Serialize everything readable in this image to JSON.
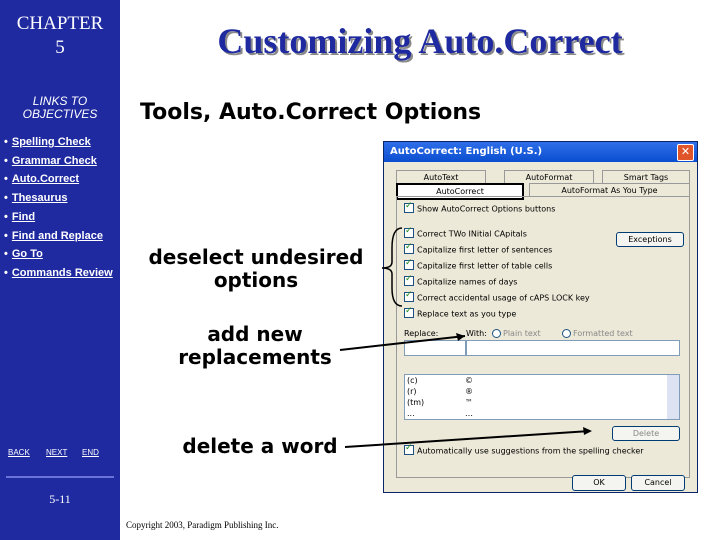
{
  "sidebar": {
    "chapter": "CHAPTER",
    "chapter_num": "5",
    "links_title_1": "LINKS TO",
    "links_title_2": "OBJECTIVES",
    "links": [
      "Spelling Check",
      "Grammar Check",
      "Auto.Correct",
      "Thesaurus",
      "Find",
      "Find and Replace",
      "Go To",
      "Commands Review"
    ],
    "nav": {
      "back": "BACK",
      "next": "NEXT",
      "end": "END"
    },
    "page_number": "5-11"
  },
  "slide": {
    "title": "Customizing Auto.Correct",
    "subtitle": "Tools, Auto.Correct Options",
    "callout_deselect": [
      "deselect undesired",
      "options"
    ],
    "callout_add": [
      "add new",
      "replacements"
    ],
    "callout_delete": "delete a word",
    "copyright": "Copyright 2003, Paradigm Publishing Inc."
  },
  "dialog": {
    "title": "AutoCorrect: English (U.S.)",
    "close": "✕",
    "tabs_top": [
      "AutoText",
      "AutoFormat",
      "Smart Tags"
    ],
    "tabs_bottom": [
      "AutoCorrect",
      "AutoFormat As You Type"
    ],
    "show_buttons": "Show AutoCorrect Options buttons",
    "options": [
      "Correct TWo INitial CApitals",
      "Capitalize first letter of sentences",
      "Capitalize first letter of table cells",
      "Capitalize names of days",
      "Correct accidental usage of cAPS LOCK key"
    ],
    "exceptions": "Exceptions",
    "replace_as_you_type": "Replace text as you type",
    "replace_label": "Replace:",
    "with_label": "With:",
    "plain_text": "Plain text",
    "formatted_text": "Formatted text",
    "replacements": [
      [
        "(c)",
        "©"
      ],
      [
        "(r)",
        "®"
      ],
      [
        "(tm)",
        "™"
      ],
      [
        "...",
        "…"
      ]
    ],
    "delete": "Delete",
    "auto_suggest": "Automatically use suggestions from the spelling checker",
    "ok": "OK",
    "cancel": "Cancel"
  },
  "colors": {
    "sidebar": "#1f2aa0",
    "title": "#1f2aa0",
    "dialog_titlebar": "#0a4ed0"
  }
}
